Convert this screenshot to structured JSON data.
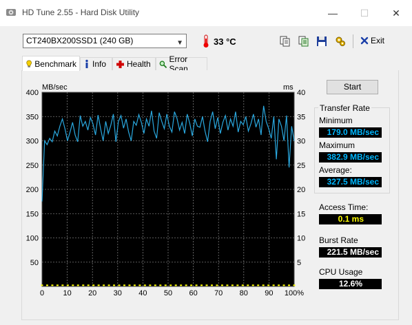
{
  "window": {
    "title": "HD Tune 2.55 - Hard Disk Utility",
    "minimize_glyph": "—",
    "maximize_glyph": "☐",
    "close_glyph": "✕"
  },
  "toolbar": {
    "drive": "CT240BX200SSD1 (240 GB)",
    "temperature": "33 °C",
    "icons": [
      "copy-icon",
      "copy-info-icon",
      "save-icon",
      "options-icon"
    ],
    "exit_label": "Exit"
  },
  "tabs": [
    {
      "label": "Benchmark",
      "icon": "benchmark-icon",
      "active": true
    },
    {
      "label": "Info",
      "icon": "info-icon",
      "active": false
    },
    {
      "label": "Health",
      "icon": "health-icon",
      "active": false
    },
    {
      "label": "Error Scan",
      "icon": "error-scan-icon",
      "active": false
    }
  ],
  "benchmark": {
    "start_label": "Start",
    "transfer_rate_title": "Transfer Rate",
    "minimum_label": "Minimum",
    "minimum_value": "179.0 MB/sec",
    "maximum_label": "Maximum",
    "maximum_value": "382.9 MB/sec",
    "average_label": "Average:",
    "average_value": "327.5 MB/sec",
    "access_time_label": "Access Time:",
    "access_time_value": "0.1 ms",
    "burst_rate_label": "Burst Rate",
    "burst_rate_value": "221.5 MB/sec",
    "cpu_usage_label": "CPU Usage",
    "cpu_usage_value": "12.6%"
  },
  "colors": {
    "transfer_line": "#2aa9e0",
    "access_points": "#ffff00",
    "plot_bg": "#000000",
    "grid": "#7a7a7a"
  },
  "chart_data": {
    "type": "line",
    "left_axis_label": "MB/sec",
    "right_axis_label": "ms",
    "y_ticks_left": [
      "400",
      "350",
      "300",
      "250",
      "200",
      "150",
      "100",
      "50"
    ],
    "y_ticks_right": [
      "40",
      "35",
      "30",
      "25",
      "20",
      "15",
      "10",
      "5"
    ],
    "x_ticks": [
      "0",
      "10",
      "20",
      "30",
      "40",
      "50",
      "60",
      "70",
      "80",
      "90",
      "100%"
    ],
    "xlim": [
      0,
      100
    ],
    "ylim": [
      0,
      400
    ],
    "y2lim": [
      0,
      40
    ],
    "grid": true,
    "series": [
      {
        "axis": "left",
        "values": [
          175,
          300,
          292,
          305,
          298,
          320,
          310,
          330,
          345,
          325,
          300,
          318,
          338,
          312,
          298,
          352,
          330,
          340,
          322,
          348,
          335,
          312,
          353,
          325,
          300,
          340,
          315,
          332,
          355,
          298,
          340,
          352,
          326,
          345,
          318,
          300,
          340,
          332,
          354,
          338,
          315,
          345,
          330,
          362,
          320,
          305,
          358,
          340,
          325,
          355,
          330,
          318,
          360,
          346,
          322,
          338,
          315,
          355,
          336,
          310,
          345,
          330,
          328,
          350,
          320,
          298,
          340,
          360,
          325,
          348,
          315,
          338,
          352,
          322,
          345,
          330,
          360,
          318,
          340,
          333,
          350,
          320,
          335,
          355,
          328,
          345,
          312,
          372,
          340,
          325,
          305,
          350,
          262,
          345,
          330,
          300,
          352,
          245,
          330,
          300
        ]
      },
      {
        "axis": "right",
        "values": [
          0.1,
          0.1,
          0.1,
          0.1,
          0.1,
          0.1,
          0.1,
          0.1,
          0.1,
          0.1,
          0.1,
          0.1,
          0.1,
          0.1,
          0.1,
          0.1,
          0.1,
          0.1,
          0.1,
          0.1,
          0.1,
          0.1,
          0.1,
          0.1,
          0.1,
          0.1,
          0.1,
          0.1,
          0.1,
          0.1,
          0.1,
          0.1,
          0.1,
          0.1,
          0.1,
          0.1,
          0.1,
          0.1,
          0.1,
          0.1,
          0.1,
          0.1,
          0.1,
          0.1,
          0.1,
          0.1,
          0.1,
          0.1,
          0.1,
          0.1
        ]
      }
    ]
  }
}
